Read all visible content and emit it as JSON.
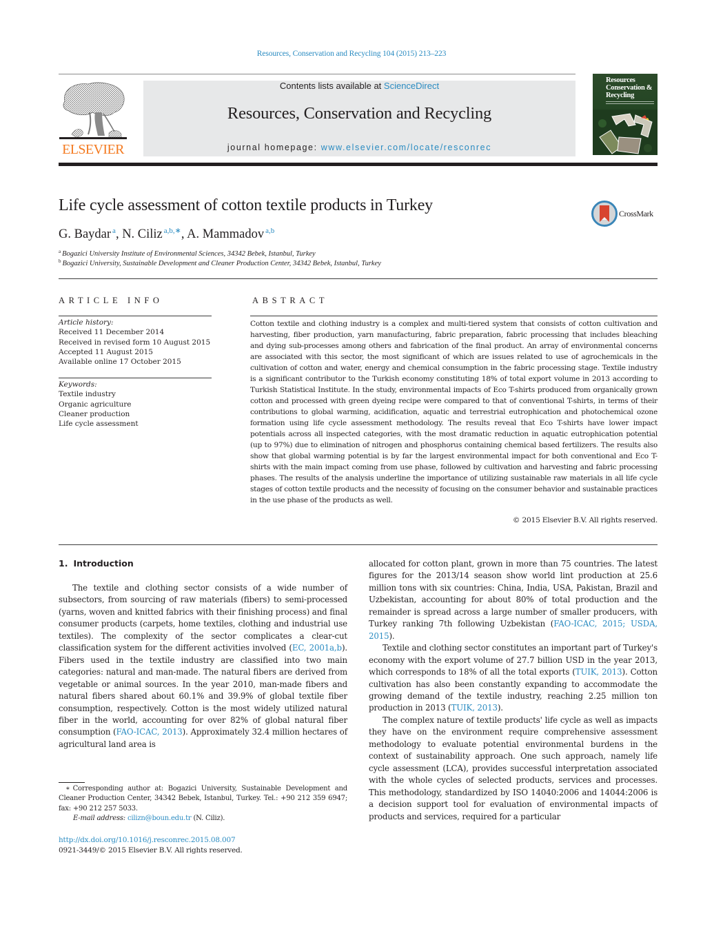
{
  "header": {
    "citation": "Resources, Conservation and Recycling 104 (2015) 213–223",
    "contents_prefix": "Contents lists available at ",
    "contents_link": "ScienceDirect",
    "journal_title": "Resources, Conservation and Recycling",
    "homepage_prefix": "journal homepage: ",
    "homepage_link": "www.elsevier.com/locate/resconrec",
    "publisher_logo_text": "ELSEVIER",
    "cover_title_lines": [
      "Resources",
      "Conservation &",
      "Recycling"
    ],
    "crossmark_label": "CrossMark"
  },
  "article": {
    "title": "Life cycle assessment of cotton textile products in Turkey",
    "authors": [
      {
        "name": "G. Baydar",
        "sup": "a",
        "sep": ", "
      },
      {
        "name": "N. Ciliz",
        "sup": "a,b,∗",
        "sep": ", "
      },
      {
        "name": "A. Mammadov",
        "sup": "a,b",
        "sep": ""
      }
    ],
    "affiliations": [
      {
        "mark": "a",
        "text": "Bogazici University Institute of Environmental Sciences, 34342 Bebek, Istanbul, Turkey"
      },
      {
        "mark": "b",
        "text": "Bogazici University, Sustainable Development and Cleaner Production Center, 34342 Bebek, Istanbul, Turkey"
      }
    ]
  },
  "article_info": {
    "heading": "ARTICLE INFO",
    "history_label": "Article history:",
    "history": [
      "Received 11 December 2014",
      "Received in revised form 10 August 2015",
      "Accepted 11 August 2015",
      "Available online 17 October 2015"
    ],
    "keywords_label": "Keywords:",
    "keywords": [
      "Textile industry",
      "Organic agriculture",
      "Cleaner production",
      "Life cycle assessment"
    ]
  },
  "abstract": {
    "heading": "ABSTRACT",
    "text": "Cotton textile and clothing industry is a complex and multi-tiered system that consists of cotton cultivation and harvesting, fiber production, yarn manufacturing, fabric preparation, fabric processing that includes bleaching and dying sub-processes among others and fabrication of the final product. An array of environmental concerns are associated with this sector, the most significant of which are issues related to use of agrochemicals in the cultivation of cotton and water, energy and chemical consumption in the fabric processing stage. Textile industry is a significant contributor to the Turkish economy constituting 18% of total export volume in 2013 according to Turkish Statistical Institute. In the study, environmental impacts of Eco T-shirts produced from organically grown cotton and processed with green dyeing recipe were compared to that of conventional T-shirts, in terms of their contributions to global warming, acidification, aquatic and terrestrial eutrophication and photochemical ozone formation using life cycle assessment methodology. The results reveal that Eco T-shirts have lower impact potentials across all inspected categories, with the most dramatic reduction in aquatic eutrophication potential (up to 97%) due to elimination of nitrogen and phosphorus containing chemical based fertilizers. The results also show that global warming potential is by far the largest environmental impact for both conventional and Eco T-shirts with the main impact coming from use phase, followed by cultivation and harvesting and fabric processing phases. The results of the analysis underline the importance of utilizing sustainable raw materials in all life cycle stages of cotton textile products and the necessity of focusing on the consumer behavior and sustainable practices in the use phase of the products as well.",
    "copyright": "© 2015 Elsevier B.V. All rights reserved."
  },
  "introduction": {
    "number": "1.",
    "heading": "Introduction",
    "left_col": {
      "p1_a": "The textile and clothing sector consists of a wide number of subsectors, from sourcing of raw materials (fibers) to semi-processed (yarns, woven and knitted fabrics with their finishing process) and final consumer products (carpets, home textiles, clothing and industrial use textiles). The complexity of the sector complicates a clear-cut classification system for the different activities involved (",
      "p1_ref1": "EC, 2001a,b",
      "p1_b": "). Fibers used in the textile industry are classified into two main categories: natural and man-made. The natural fibers are derived from vegetable or animal sources. In the year 2010, man-made fibers and natural fibers shared about 60.1% and 39.9% of global textile fiber consumption, respectively. Cotton is the most widely utilized natural fiber in the world, accounting for over 82% of global natural fiber consumption (",
      "p1_ref2": "FAO-ICAC, 2013",
      "p1_c": "). Approximately 32.4 million hectares of agricultural land area is"
    },
    "right_col": {
      "p1_a": "allocated for cotton plant, grown in more than 75 countries. The latest figures for the 2013/14 season show world lint production at 25.6 million tons with six countries: China, India, USA, Pakistan, Brazil and Uzbekistan, accounting for about 80% of total production and the remainder is spread across a large number of smaller producers, with Turkey ranking 7th following Uzbekistan (",
      "p1_ref": "FAO-ICAC, 2015; USDA, 2015",
      "p1_b": ").",
      "p2_a": "Textile and clothing sector constitutes an important part of Turkey's economy with the export volume of 27.7 billion USD in the year 2013, which corresponds to 18% of all the total exports (",
      "p2_ref1": "TUIK, 2013",
      "p2_b": "). Cotton cultivation has also been constantly expanding to accommodate the growing demand of the textile industry, reaching 2.25 million ton production in 2013 (",
      "p2_ref2": "TUIK, 2013",
      "p2_c": ").",
      "p3": "The complex nature of textile products' life cycle as well as impacts they have on the environment require comprehensive assessment methodology to evaluate potential environmental burdens in the context of sustainability approach. One such approach, namely life cycle assessment (LCA), provides successful interpretation associated with the whole cycles of selected products, services and processes. This methodology, standardized by ISO 14040:2006 and 14044:2006 is a decision support tool for evaluation of environmental impacts of products and services, required for a particular"
    }
  },
  "footnote": {
    "star": "∗",
    "corresponding": "Corresponding author at: Bogazici University, Sustainable Development and Cleaner Production Center, 34342 Bebek, Istanbul, Turkey. Tel.: +90 212 359 6947; fax: +90 212 257 5033.",
    "email_label": "E-mail address:",
    "email": "cilizn@boun.edu.tr",
    "email_suffix": " (N. Ciliz)."
  },
  "doi": {
    "link": "http://dx.doi.org/10.1016/j.resconrec.2015.08.007",
    "issn_line": "0921-3449/© 2015 Elsevier B.V. All rights reserved."
  },
  "colors": {
    "link": "#2a8bc1",
    "elsevier_orange": "#f47a20",
    "banner_gray": "#e7e8e9",
    "text": "#231f20"
  }
}
